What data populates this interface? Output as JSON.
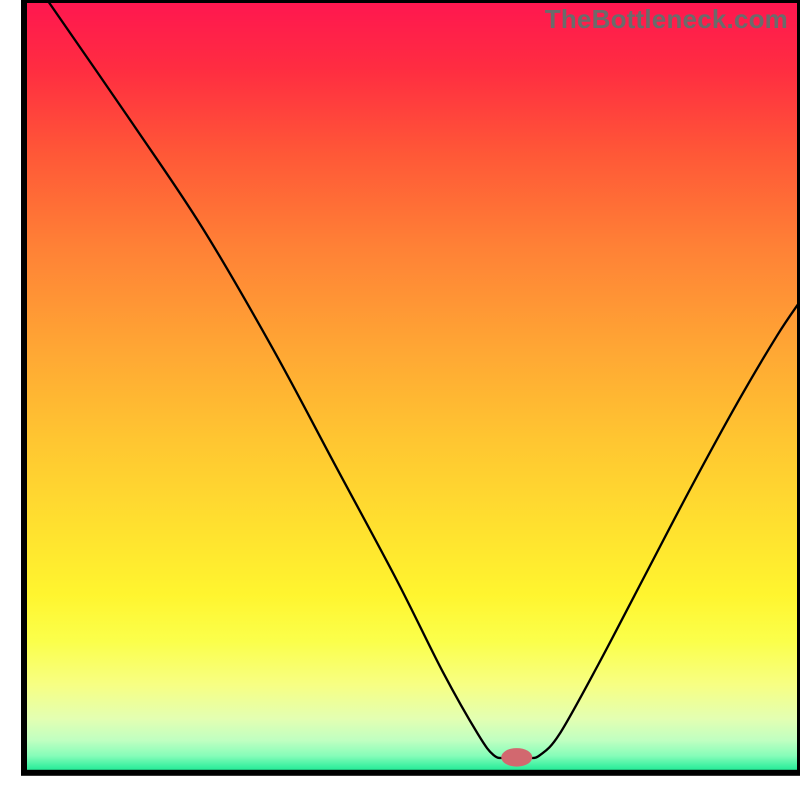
{
  "watermark": "TheBottleneck.com",
  "chart_data": {
    "type": "line",
    "title": "",
    "xlabel": "",
    "ylabel": "",
    "xlim": [
      0,
      100
    ],
    "ylim": [
      0,
      100
    ],
    "background_gradient_stops": [
      {
        "offset": 0.0,
        "color": "#ff1650"
      },
      {
        "offset": 0.09,
        "color": "#ff2d41"
      },
      {
        "offset": 0.2,
        "color": "#ff5837"
      },
      {
        "offset": 0.32,
        "color": "#ff8136"
      },
      {
        "offset": 0.45,
        "color": "#ffa634"
      },
      {
        "offset": 0.57,
        "color": "#ffc631"
      },
      {
        "offset": 0.68,
        "color": "#ffe02f"
      },
      {
        "offset": 0.77,
        "color": "#fff52f"
      },
      {
        "offset": 0.83,
        "color": "#fbff4b"
      },
      {
        "offset": 0.886,
        "color": "#f7ff83"
      },
      {
        "offset": 0.93,
        "color": "#e3ffb2"
      },
      {
        "offset": 0.958,
        "color": "#c0ffc1"
      },
      {
        "offset": 0.978,
        "color": "#86fdb9"
      },
      {
        "offset": 0.992,
        "color": "#3af0a0"
      },
      {
        "offset": 1.0,
        "color": "#19e58f"
      }
    ],
    "marker": {
      "x": 63.5,
      "y": 2.0,
      "rx": 2.0,
      "ry": 1.2,
      "fill": "#d2686f"
    },
    "series": [
      {
        "name": "bottleneck-curve",
        "stroke": "#000000",
        "stroke_width": 2.3,
        "points": [
          {
            "x": 3.0,
            "y": 100.0
          },
          {
            "x": 14.0,
            "y": 84.0
          },
          {
            "x": 23.0,
            "y": 70.5
          },
          {
            "x": 32.0,
            "y": 55.0
          },
          {
            "x": 40.0,
            "y": 40.0
          },
          {
            "x": 48.0,
            "y": 25.0
          },
          {
            "x": 54.0,
            "y": 13.0
          },
          {
            "x": 58.5,
            "y": 5.0
          },
          {
            "x": 60.5,
            "y": 2.3
          },
          {
            "x": 62.0,
            "y": 1.9
          },
          {
            "x": 65.0,
            "y": 1.9
          },
          {
            "x": 66.5,
            "y": 2.3
          },
          {
            "x": 69.0,
            "y": 5.0
          },
          {
            "x": 74.0,
            "y": 14.0
          },
          {
            "x": 80.0,
            "y": 25.5
          },
          {
            "x": 86.0,
            "y": 37.0
          },
          {
            "x": 92.0,
            "y": 48.0
          },
          {
            "x": 97.0,
            "y": 56.5
          },
          {
            "x": 100.0,
            "y": 61.0
          }
        ]
      }
    ],
    "frame": {
      "x1": 3.0,
      "y1": 3.4,
      "x2": 100.0,
      "y2": 100.0,
      "stroke": "#000000",
      "stroke_width": 6
    }
  }
}
